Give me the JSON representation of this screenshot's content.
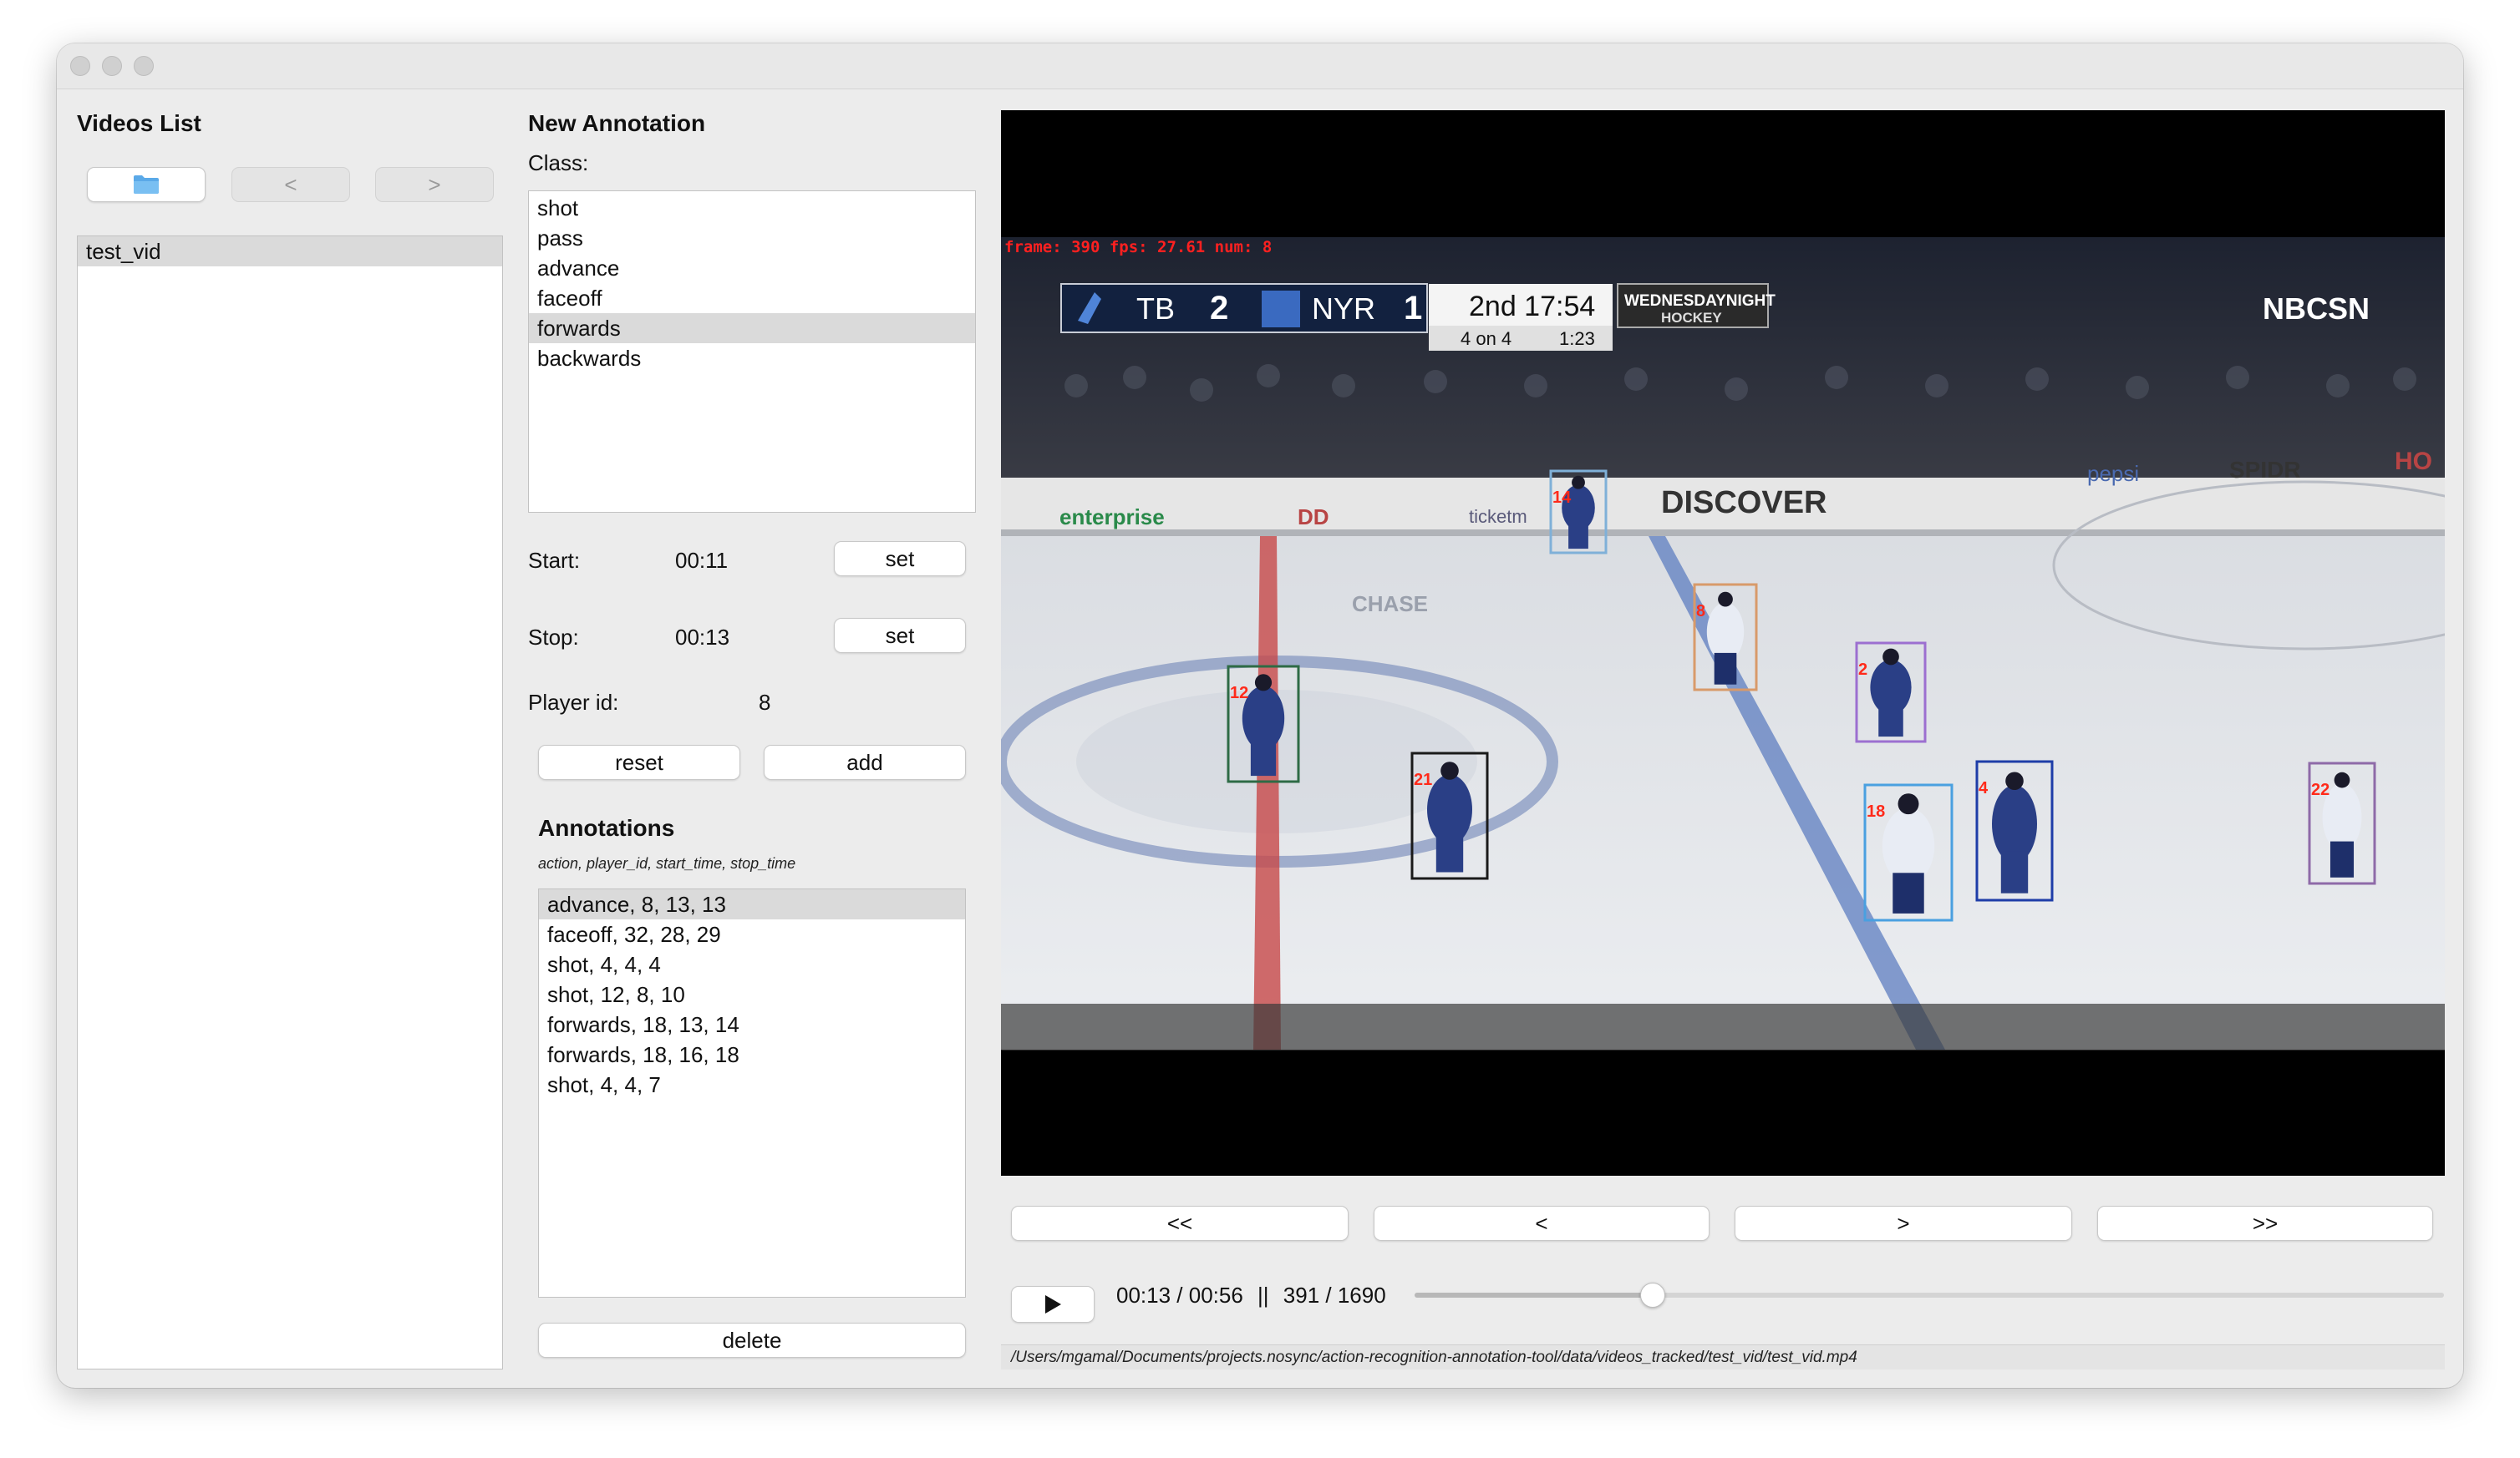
{
  "videos_panel": {
    "title": "Videos List",
    "open_folder_icon": "folder-icon",
    "prev_label": "<",
    "next_label": ">",
    "items": [
      "test_vid"
    ],
    "selected_index": 0
  },
  "annotation_panel": {
    "title": "New Annotation",
    "class_label": "Class:",
    "classes": [
      "shot",
      "pass",
      "advance",
      "faceoff",
      "forwards",
      "backwards"
    ],
    "selected_class_index": 4,
    "start_label": "Start:",
    "start_value": "00:11",
    "stop_label": "Stop:",
    "stop_value": "00:13",
    "set_label": "set",
    "player_id_label": "Player id:",
    "player_id_value": "8",
    "reset_label": "reset",
    "add_label": "add"
  },
  "annotations": {
    "title": "Annotations",
    "header": "action, player_id, start_time, stop_time",
    "rows": [
      "advance, 8, 13, 13",
      "faceoff, 32, 28, 29",
      "shot, 4, 4, 4",
      "shot, 12, 8, 10",
      "forwards, 18, 13, 14",
      "forwards, 18, 16, 18",
      "shot, 4, 4, 7"
    ],
    "selected_index": 0,
    "delete_label": "delete"
  },
  "video": {
    "overlay_text": "frame: 390 fps: 27.61 num: 8",
    "scorebug": {
      "team1": "TB",
      "score1": "2",
      "team2": "NYR",
      "score2": "1",
      "period_clock": "2nd 17:54",
      "strength": "4 on 4",
      "pp_time": "1:23",
      "show_line1": "WEDNESDAYNIGHT",
      "show_line2": "HOCKEY"
    },
    "network_logo": "NBCSN",
    "ads": [
      "enterprise",
      "DD",
      "ticketm",
      "DISCOVER",
      "pepsi",
      "SPIDR",
      "HO",
      "CHASE"
    ],
    "players": [
      {
        "id": "12",
        "color": "#2e6b45"
      },
      {
        "id": "21",
        "color": "#1a1a1a"
      },
      {
        "id": "14",
        "color": "#7fb0d8"
      },
      {
        "id": "8",
        "color": "#d89a6a"
      },
      {
        "id": "2",
        "color": "#9c6fd0"
      },
      {
        "id": "18",
        "color": "#4aa0e0"
      },
      {
        "id": "4",
        "color": "#1e3da8"
      },
      {
        "id": "22",
        "color": "#8e6aa8"
      }
    ]
  },
  "controls": {
    "rewind_label": "<<",
    "prev_frame_label": "<",
    "next_frame_label": ">",
    "forward_label": ">>",
    "play_icon": "play-icon",
    "time_text": "00:13 / 00:56",
    "separator": "||",
    "frame_text": "391 / 1690",
    "progress": 0.2314
  },
  "file_path": "/Users/mgamal/Documents/projects.nosync/action-recognition-annotation-tool/data/videos_tracked/test_vid/test_vid.mp4"
}
